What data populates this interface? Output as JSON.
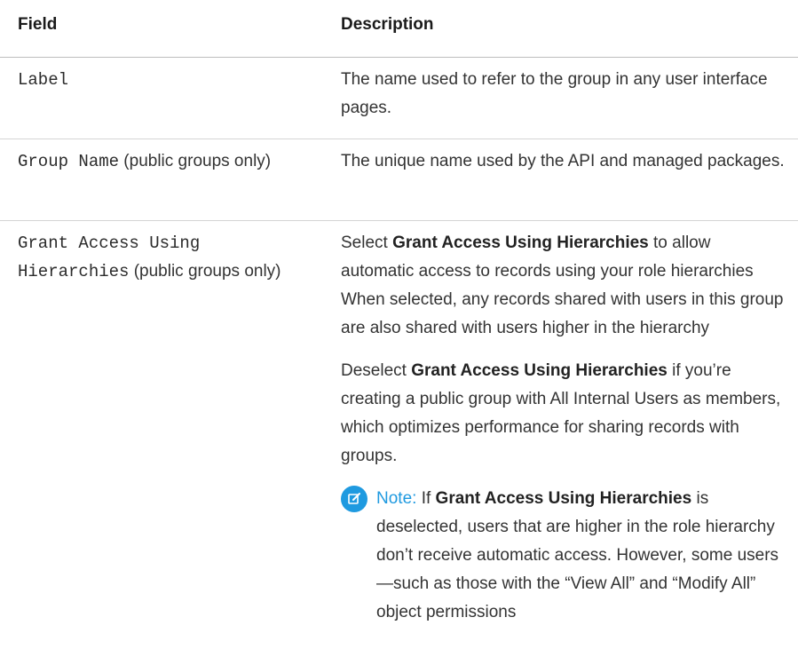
{
  "table": {
    "headers": {
      "field": "Field",
      "description": "Description"
    },
    "rows": [
      {
        "field_code": "Label",
        "description": "The name used to refer to the group in any user interface pages."
      },
      {
        "field_code": "Group Name",
        "field_suffix": " (public groups only)",
        "description": "The unique name used by the API and managed packages."
      },
      {
        "field_code_line1": "Grant Access Using",
        "field_code_line2": "Hierarchies",
        "field_suffix": " (public groups only)",
        "para1": {
          "pre": "Select ",
          "bold": "Grant Access Using Hierarchies",
          "post": " to allow automatic access to records using your role hierarchies When selected, any records shared with users in this group are also shared with users higher in the hierarchy"
        },
        "para2": {
          "pre": "Deselect ",
          "bold": "Grant Access Using Hierarchies",
          "post": " if you’re creating a public group with All Internal Users as members, which optimizes performance for sharing records with groups."
        },
        "note": {
          "label": "Note:",
          "pre": "  If ",
          "bold": "Grant Access Using Hierarchies",
          "post": " is deselected, users that are higher in the role hierarchy don’t receive automatic access. However, some users—such as those with the “View All” and “Modify All” object permissions",
          "icon": "note-edit-icon",
          "icon_color": "#1f9ae0"
        }
      }
    ]
  }
}
